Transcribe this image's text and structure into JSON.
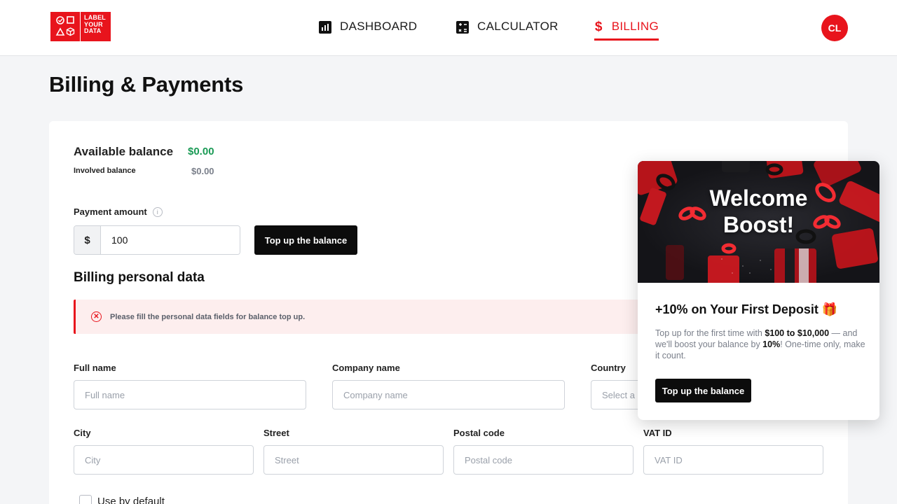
{
  "logo": {
    "text_line1": "LABEL",
    "text_line2": "YOUR",
    "text_line3": "DATA"
  },
  "nav": [
    {
      "label": "DASHBOARD",
      "icon": "bar-chart-icon"
    },
    {
      "label": "CALCULATOR",
      "icon": "calculator-icon"
    },
    {
      "label": "BILLING",
      "icon": "dollar-icon",
      "active": true
    }
  ],
  "nav_dollar_glyph": "$",
  "user": {
    "initials": "CL"
  },
  "page": {
    "title": "Billing & Payments"
  },
  "balance": {
    "available_label": "Available balance",
    "available_value": "$0.00",
    "involved_label": "Involved balance",
    "involved_value": "$0.00"
  },
  "payment": {
    "label": "Payment amount",
    "info_glyph": "i",
    "currency": "$",
    "amount": "100",
    "button": "Top up the balance"
  },
  "billing": {
    "title": "Billing personal data",
    "alert_glyph": "✕",
    "alert": "Please fill the personal data fields for balance top up.",
    "fields": {
      "full_name": {
        "label": "Full name",
        "placeholder": "Full name"
      },
      "company_name": {
        "label": "Company name",
        "placeholder": "Company name"
      },
      "country": {
        "label": "Country",
        "placeholder": "Select a"
      },
      "city": {
        "label": "City",
        "placeholder": "City"
      },
      "street": {
        "label": "Street",
        "placeholder": "Street"
      },
      "postal_code": {
        "label": "Postal code",
        "placeholder": "Postal code"
      },
      "vat_id": {
        "label": "VAT ID",
        "placeholder": "VAT ID"
      }
    },
    "use_default": "Use by default"
  },
  "popup": {
    "banner_title_line1": "Welcome",
    "banner_title_line2": "Boost!",
    "heading": "+10% on Your First Deposit 🎁",
    "text_1": "Top up for the first time with ",
    "text_range": "$100 to $10,000",
    "text_2": " — and we'll boost your balance by ",
    "text_percent": "10%",
    "text_3": "! One-time only, make it count.",
    "button": "Top up the balance"
  },
  "colors": {
    "accent": "#e8141c",
    "positive": "#1a9a55",
    "dark": "#0c0c0c"
  }
}
